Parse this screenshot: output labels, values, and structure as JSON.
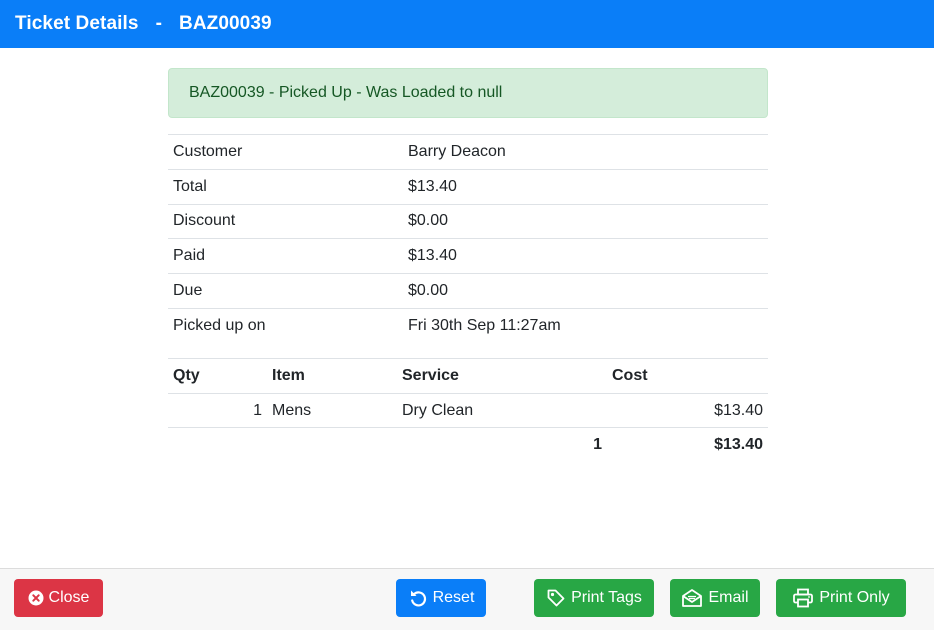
{
  "header": {
    "title": "Ticket Details",
    "separator": "-",
    "ticket_id": "BAZ00039"
  },
  "alert": {
    "message": "BAZ00039 - Picked Up - Was Loaded to null",
    "color": "#d4edda"
  },
  "details": [
    {
      "label": "Customer",
      "value": "Barry Deacon"
    },
    {
      "label": "Total",
      "value": "$13.40"
    },
    {
      "label": "Discount",
      "value": "$0.00"
    },
    {
      "label": "Paid",
      "value": "$13.40"
    },
    {
      "label": "Due",
      "value": "$0.00"
    },
    {
      "label": "Picked up on",
      "value": "Fri 30th Sep 11:27am"
    }
  ],
  "items_table": {
    "headers": {
      "qty": "Qty",
      "item": "Item",
      "service": "Service",
      "cost": "Cost"
    },
    "rows": [
      {
        "qty": "1",
        "item": "Mens",
        "service": "Dry Clean",
        "cost": "$13.40"
      }
    ],
    "totals": {
      "qty": "1",
      "cost": "$13.40"
    }
  },
  "footer": {
    "close_label": "Close",
    "reset_label": "Reset",
    "print_tags_label": "Print Tags",
    "email_label": "Email",
    "print_only_label": "Print Only"
  },
  "icons": {
    "close": "times-circle-icon",
    "reset": "undo-icon",
    "print_tags": "tag-icon",
    "email": "envelope-open-icon",
    "print_only": "printer-icon"
  },
  "colors": {
    "primary": "#0a7ef8",
    "danger": "#dc3545",
    "success": "#28a745"
  }
}
